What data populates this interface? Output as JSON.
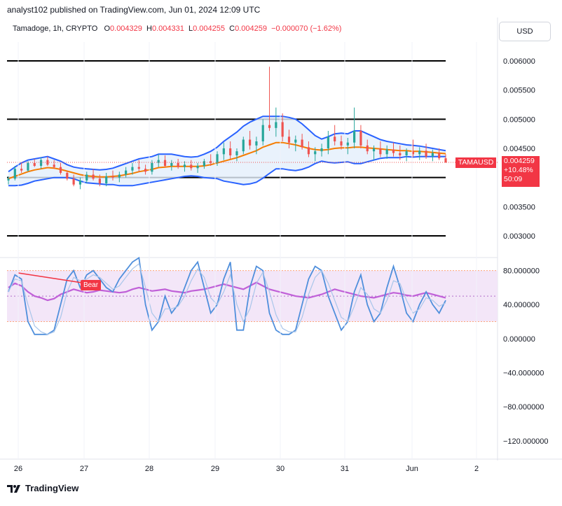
{
  "header": {
    "published": "analyst102 published on TradingView.com, Jun 01, 2024 12:09 UTC"
  },
  "legend": {
    "symbol": "Tamadoge, 1h, CRYPTO",
    "o_label": "O",
    "o_value": "0.004329",
    "h_label": "H",
    "h_value": "0.004331",
    "l_label": "L",
    "l_value": "0.004255",
    "c_label": "C",
    "c_value": "0.004259",
    "change": "−0.000070 (−1.62%)"
  },
  "currency_button": "USD",
  "price_tag": {
    "symbol": "TAMAUSD",
    "price": "0.004259",
    "change": "+10.48%",
    "countdown": "50:09"
  },
  "bear_label": "Bear",
  "footer": {
    "brand": "TradingView"
  },
  "colors": {
    "up": "#26a69a",
    "down": "#ef5350",
    "band": "#2962ff",
    "band_fill": "#e3effb",
    "mid": "#f57c00",
    "rsi": "#c060d8",
    "stoch_k": "#4f8fdc",
    "stoch_d": "#a9c6ea",
    "rsi_band_fill": "#f3e6f8",
    "bear": "#f23645"
  },
  "chart_data": [
    {
      "type": "candlestick",
      "price_axis": {
        "ticks": [
          "0.006000",
          "0.005500",
          "0.005000",
          "0.004500",
          "0.003500",
          "0.003000"
        ],
        "min": 0.0027,
        "max": 0.0063
      },
      "x_ticks": [
        "26",
        "27",
        "28",
        "29",
        "30",
        "31",
        "Jun",
        "2"
      ],
      "horizontal_levels": [
        0.006,
        0.005,
        0.004,
        0.003
      ],
      "ohlc": [
        [
          0.00395,
          0.00402,
          0.00388,
          0.00398
        ],
        [
          0.00398,
          0.0042,
          0.00395,
          0.00415
        ],
        [
          0.00415,
          0.00425,
          0.00408,
          0.00412
        ],
        [
          0.00412,
          0.00428,
          0.0041,
          0.00425
        ],
        [
          0.00425,
          0.00432,
          0.00418,
          0.0042
        ],
        [
          0.0042,
          0.00435,
          0.00415,
          0.0043
        ],
        [
          0.0043,
          0.00436,
          0.0042,
          0.00422
        ],
        [
          0.00422,
          0.0043,
          0.00415,
          0.00418
        ],
        [
          0.00418,
          0.00425,
          0.00405,
          0.00408
        ],
        [
          0.00408,
          0.00412,
          0.00395,
          0.00398
        ],
        [
          0.00398,
          0.00405,
          0.00385,
          0.00388
        ],
        [
          0.00388,
          0.004,
          0.0038,
          0.00395
        ],
        [
          0.00395,
          0.0041,
          0.0039,
          0.00405
        ],
        [
          0.00405,
          0.00415,
          0.00395,
          0.00398
        ],
        [
          0.00398,
          0.00405,
          0.00385,
          0.0039
        ],
        [
          0.0039,
          0.00408,
          0.00385,
          0.00402
        ],
        [
          0.00402,
          0.00412,
          0.00395,
          0.004
        ],
        [
          0.004,
          0.0041,
          0.00392,
          0.00405
        ],
        [
          0.00405,
          0.00418,
          0.004,
          0.00412
        ],
        [
          0.00412,
          0.00425,
          0.00405,
          0.00418
        ],
        [
          0.00418,
          0.0043,
          0.0041,
          0.00415
        ],
        [
          0.00415,
          0.00422,
          0.00405,
          0.0041
        ],
        [
          0.0041,
          0.0043,
          0.00405,
          0.00425
        ],
        [
          0.00425,
          0.0044,
          0.00418,
          0.0043
        ],
        [
          0.0043,
          0.00438,
          0.00418,
          0.0042
        ],
        [
          0.0042,
          0.0043,
          0.00412,
          0.00425
        ],
        [
          0.00425,
          0.00432,
          0.00415,
          0.00418
        ],
        [
          0.00418,
          0.00428,
          0.0041,
          0.00422
        ],
        [
          0.00422,
          0.0043,
          0.00412,
          0.00416
        ],
        [
          0.00416,
          0.00425,
          0.00408,
          0.0042
        ],
        [
          0.0042,
          0.00432,
          0.00415,
          0.00428
        ],
        [
          0.00428,
          0.0044,
          0.0042,
          0.00425
        ],
        [
          0.00425,
          0.00445,
          0.0042,
          0.0044
        ],
        [
          0.0044,
          0.0046,
          0.0043,
          0.0045
        ],
        [
          0.0045,
          0.00462,
          0.00432,
          0.00438
        ],
        [
          0.00438,
          0.0045,
          0.00428,
          0.00445
        ],
        [
          0.00445,
          0.0047,
          0.0044,
          0.00465
        ],
        [
          0.00465,
          0.0048,
          0.00448,
          0.00455
        ],
        [
          0.00455,
          0.0047,
          0.0044,
          0.00462
        ],
        [
          0.00462,
          0.005,
          0.00455,
          0.0049
        ],
        [
          0.0049,
          0.0059,
          0.0048,
          0.00485
        ],
        [
          0.00485,
          0.0052,
          0.0047,
          0.00495
        ],
        [
          0.00495,
          0.0051,
          0.00462,
          0.0047
        ],
        [
          0.0047,
          0.00482,
          0.0045,
          0.0046
        ],
        [
          0.0046,
          0.00472,
          0.00445,
          0.00465
        ],
        [
          0.00465,
          0.00475,
          0.00448,
          0.00452
        ],
        [
          0.00452,
          0.00462,
          0.00435,
          0.0044
        ],
        [
          0.0044,
          0.00452,
          0.00428,
          0.00445
        ],
        [
          0.00445,
          0.00458,
          0.00436,
          0.0045
        ],
        [
          0.0045,
          0.0048,
          0.0044,
          0.0047
        ],
        [
          0.0047,
          0.0049,
          0.00455,
          0.00462
        ],
        [
          0.00462,
          0.00472,
          0.00448,
          0.00455
        ],
        [
          0.00455,
          0.00468,
          0.0044,
          0.0046
        ],
        [
          0.0046,
          0.0052,
          0.0045,
          0.0048
        ],
        [
          0.0048,
          0.0049,
          0.0045,
          0.00455
        ],
        [
          0.00455,
          0.00465,
          0.0044,
          0.00445
        ],
        [
          0.00445,
          0.00455,
          0.0043,
          0.0045
        ],
        [
          0.0045,
          0.00462,
          0.00435,
          0.0044
        ],
        [
          0.0044,
          0.00455,
          0.00432,
          0.00448
        ],
        [
          0.00448,
          0.0046,
          0.00436,
          0.00442
        ],
        [
          0.00442,
          0.00455,
          0.0043,
          0.00438
        ],
        [
          0.00438,
          0.0045,
          0.00428,
          0.00445
        ],
        [
          0.00445,
          0.00465,
          0.00435,
          0.0044
        ],
        [
          0.0044,
          0.00452,
          0.0043,
          0.00446
        ],
        [
          0.00446,
          0.00458,
          0.00432,
          0.00436
        ],
        [
          0.00436,
          0.00448,
          0.00428,
          0.00442
        ],
        [
          0.00442,
          0.0045,
          0.0043,
          0.00433
        ],
        [
          0.00433,
          0.0044,
          0.00425,
          0.00426
        ]
      ],
      "bollinger": {
        "upper": [
          0.0041,
          0.00418,
          0.00425,
          0.0043,
          0.00432,
          0.00434,
          0.00436,
          0.00432,
          0.00428,
          0.00422,
          0.00418,
          0.00416,
          0.00415,
          0.00414,
          0.00413,
          0.00414,
          0.00416,
          0.0042,
          0.00424,
          0.00428,
          0.00432,
          0.00434,
          0.00436,
          0.0044,
          0.0044,
          0.0044,
          0.00438,
          0.00436,
          0.00435,
          0.00436,
          0.0044,
          0.00445,
          0.00452,
          0.00462,
          0.0047,
          0.00478,
          0.00488,
          0.00495,
          0.005,
          0.00505,
          0.00505,
          0.00505,
          0.00505,
          0.00503,
          0.005,
          0.00492,
          0.00482,
          0.00472,
          0.00466,
          0.0047,
          0.00475,
          0.00476,
          0.00475,
          0.0048,
          0.0048,
          0.00475,
          0.0047,
          0.00465,
          0.00462,
          0.0046,
          0.00458,
          0.00456,
          0.00455,
          0.00454,
          0.00452,
          0.0045,
          0.00448,
          0.00446
        ],
        "middle": [
          0.00398,
          0.00402,
          0.00406,
          0.0041,
          0.00413,
          0.00415,
          0.00417,
          0.00416,
          0.00414,
          0.00411,
          0.00408,
          0.00405,
          0.00403,
          0.00402,
          0.00401,
          0.00401,
          0.00402,
          0.00403,
          0.00405,
          0.00407,
          0.0041,
          0.00412,
          0.00414,
          0.00417,
          0.00418,
          0.00419,
          0.00419,
          0.00419,
          0.00419,
          0.00419,
          0.0042,
          0.00422,
          0.00425,
          0.00428,
          0.00431,
          0.00434,
          0.00438,
          0.00442,
          0.00446,
          0.00452,
          0.00456,
          0.0046,
          0.0046,
          0.00458,
          0.00456,
          0.00453,
          0.0045,
          0.00448,
          0.00447,
          0.00448,
          0.0045,
          0.00451,
          0.00451,
          0.00452,
          0.00452,
          0.00451,
          0.0045,
          0.00449,
          0.00448,
          0.00447,
          0.00446,
          0.00446,
          0.00445,
          0.00445,
          0.00444,
          0.00443,
          0.00442,
          0.00441
        ],
        "lower": [
          0.00386,
          0.00386,
          0.00387,
          0.0039,
          0.00394,
          0.00396,
          0.00398,
          0.004,
          0.004,
          0.004,
          0.00398,
          0.00394,
          0.00391,
          0.0039,
          0.00389,
          0.00388,
          0.00388,
          0.00386,
          0.00386,
          0.00386,
          0.00388,
          0.0039,
          0.00392,
          0.00394,
          0.00396,
          0.00398,
          0.004,
          0.00402,
          0.00403,
          0.00402,
          0.004,
          0.00399,
          0.00398,
          0.00394,
          0.00392,
          0.0039,
          0.00388,
          0.00389,
          0.00392,
          0.00399,
          0.00407,
          0.00415,
          0.00415,
          0.00413,
          0.00412,
          0.00414,
          0.00418,
          0.00424,
          0.00428,
          0.00426,
          0.00425,
          0.00426,
          0.00427,
          0.00424,
          0.00424,
          0.00427,
          0.0043,
          0.00433,
          0.00434,
          0.00434,
          0.00434,
          0.00436,
          0.00435,
          0.00436,
          0.00436,
          0.00436,
          0.00436,
          0.00436
        ]
      }
    },
    {
      "type": "line",
      "indicator_axis": {
        "ticks": [
          "80.000000",
          "40.000000",
          "0.000000",
          "−40.000000",
          "−80.000000",
          "−120.000000"
        ],
        "min": -135,
        "max": 92
      },
      "band": [
        20,
        80
      ],
      "series": [
        {
          "values": [
            60,
            65,
            62,
            55,
            50,
            48,
            45,
            47,
            52,
            55,
            58,
            56,
            54,
            55,
            57,
            56,
            55,
            54,
            55,
            58,
            60,
            58,
            56,
            57,
            58,
            56,
            55,
            54,
            56,
            57,
            58,
            60,
            62,
            64,
            62,
            60,
            58,
            62,
            66,
            62,
            58,
            56,
            54,
            52,
            50,
            49,
            48,
            50,
            52,
            55,
            58,
            56,
            54,
            52,
            50,
            49,
            48,
            50,
            52,
            54,
            53,
            51,
            50,
            52,
            54,
            52,
            50,
            48
          ]
        },
        {
          "values": [
            55,
            75,
            70,
            20,
            5,
            5,
            5,
            10,
            40,
            70,
            80,
            60,
            75,
            80,
            70,
            60,
            55,
            70,
            80,
            90,
            95,
            40,
            10,
            20,
            50,
            30,
            40,
            60,
            80,
            90,
            60,
            30,
            40,
            70,
            90,
            10,
            10,
            60,
            85,
            80,
            30,
            10,
            5,
            5,
            10,
            40,
            70,
            85,
            80,
            50,
            30,
            10,
            20,
            55,
            75,
            40,
            20,
            30,
            60,
            85,
            60,
            30,
            20,
            40,
            55,
            40,
            30,
            45
          ]
        },
        {
          "values": [
            55,
            70,
            68,
            40,
            15,
            8,
            5,
            8,
            25,
            55,
            72,
            68,
            70,
            75,
            72,
            65,
            58,
            62,
            72,
            82,
            88,
            60,
            30,
            20,
            35,
            35,
            38,
            50,
            68,
            82,
            72,
            48,
            40,
            55,
            75,
            40,
            20,
            35,
            65,
            78,
            55,
            28,
            12,
            8,
            8,
            25,
            52,
            72,
            80,
            65,
            45,
            25,
            20,
            38,
            60,
            52,
            35,
            30,
            45,
            68,
            65,
            45,
            30,
            35,
            48,
            45,
            38,
            42
          ]
        }
      ]
    }
  ]
}
